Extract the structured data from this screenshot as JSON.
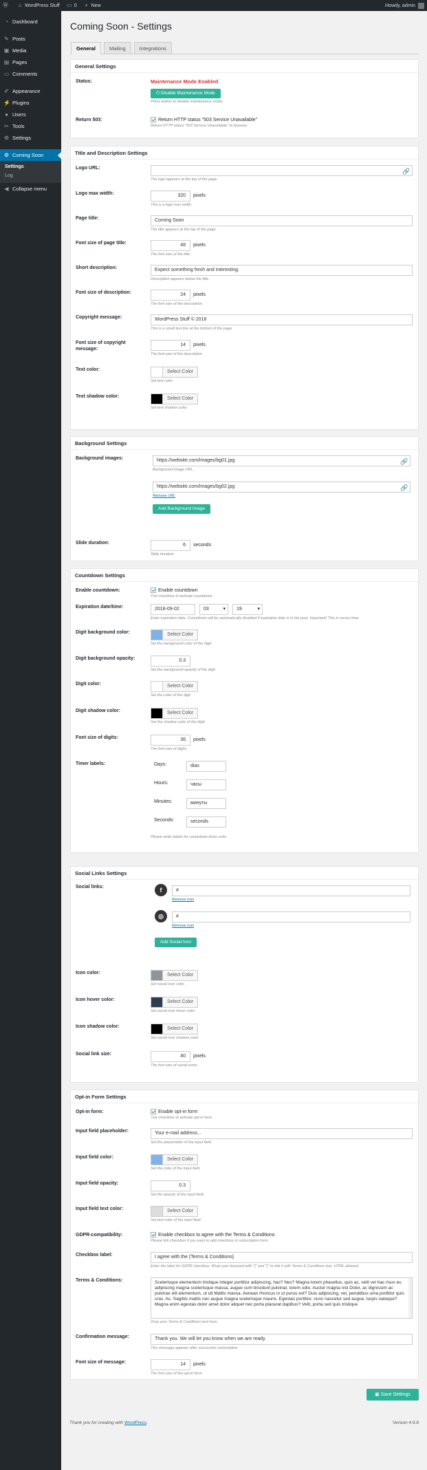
{
  "adminbar": {
    "wp_logo": "wordpress-icon",
    "site_name": "WordPress Stuff",
    "comments_count": "0",
    "new_label": "New",
    "howdy": "Howdy, admin"
  },
  "sidebar": {
    "items": [
      {
        "label": "Dashboard",
        "icon": "dashboard-icon"
      },
      {
        "label": "Posts",
        "icon": "pin-icon"
      },
      {
        "label": "Media",
        "icon": "media-icon"
      },
      {
        "label": "Pages",
        "icon": "page-icon"
      },
      {
        "label": "Comments",
        "icon": "comment-icon"
      },
      {
        "label": "Appearance",
        "icon": "brush-icon"
      },
      {
        "label": "Plugins",
        "icon": "plug-icon"
      },
      {
        "label": "Users",
        "icon": "user-icon"
      },
      {
        "label": "Tools",
        "icon": "wrench-icon"
      },
      {
        "label": "Settings",
        "icon": "settings-icon"
      },
      {
        "label": "Coming Soon",
        "icon": "gear-icon"
      }
    ],
    "sub": [
      "Settings",
      "Log"
    ],
    "collapse": "Collapse menu"
  },
  "page": {
    "title": "Coming Soon - Settings",
    "tabs": [
      "General",
      "Mailing",
      "Integrations"
    ]
  },
  "general": {
    "heading": "General Settings",
    "status_label": "Status:",
    "status_value": "Maintenance Mode Enabled",
    "disable_btn": "Disable Maintenance Mode",
    "disable_desc": "Press button to disable maintenance mode.",
    "r503_label": "Return 503:",
    "r503_check": "Return HTTP status \"503 Service Unavailable\"",
    "r503_desc": "Return HTTP status \"503 Service Unavailable\" to browser."
  },
  "title_desc": {
    "heading": "Title and Description Settings",
    "logo_url_label": "Logo URL:",
    "logo_url_value": "",
    "logo_url_desc": "The logo appears at the top of the page.",
    "logo_max_label": "Logo max width:",
    "logo_max_value": "320",
    "logo_max_unit": "pixels",
    "logo_max_desc": "This is a logo max width.",
    "page_title_label": "Page title:",
    "page_title_value": "Coming Soon",
    "page_title_desc": "The title appears at the top of the page.",
    "font_title_label": "Font size of page title:",
    "font_title_value": "48",
    "font_title_unit": "pixels",
    "font_title_desc": "The font size of the title.",
    "short_desc_label": "Short description:",
    "short_desc_value": "Expect something fresh and interesting.",
    "short_desc_desc": "Description appears below the title.",
    "font_desc_label": "Font size of description:",
    "font_desc_value": "24",
    "font_desc_unit": "pixels",
    "font_desc_desc": "The font size of the description.",
    "copyright_label": "Copyright message:",
    "copyright_value": "WordPress Stuff © 2018",
    "copyright_desc": "This is a small text line at the bottom of the page.",
    "font_copy_label": "Font size of copyright message:",
    "font_copy_value": "14",
    "font_copy_unit": "pixels",
    "font_copy_desc": "The font size of the description.",
    "text_color_label": "Text color:",
    "text_color_btn": "Select Color",
    "text_color_desc": "Set text color.",
    "text_color_value": "#ffffff",
    "shadow_color_label": "Text shadow color:",
    "shadow_color_btn": "Select Color",
    "shadow_color_desc": "Set text shadow color.",
    "shadow_color_value": "#000000"
  },
  "background": {
    "heading": "Background Settings",
    "images_label": "Background images:",
    "image1": "https://website.com/images/bg01.jpg",
    "image1_desc": "Background image URL.",
    "image2": "https://website.com/images/bg02.jpg",
    "remove_url": "Remove URL",
    "add_btn": "Add Background Image",
    "slide_label": "Slide duration:",
    "slide_value": "6",
    "slide_unit": "seconds",
    "slide_desc": "Slide duration."
  },
  "countdown": {
    "heading": "Countdown Settings",
    "enable_label": "Enable countdown:",
    "enable_check": "Enable countdown",
    "enable_desc": "Tick checkbox to activate countdown.",
    "exp_label": "Expiration date/time:",
    "exp_date": "2018-09-02",
    "exp_hour": "03",
    "exp_min": "19",
    "exp_desc": "Enter expiration date. Countdown will be automatically disabled if expiration date is in the past. Important! This is server time.",
    "digit_bg_label": "Digit background color:",
    "digit_bg_btn": "Select Color",
    "digit_bg_desc": "Set the background color of the digit.",
    "digit_bg_value": "#7fb3e6",
    "digit_op_label": "Digit background opacity:",
    "digit_op_value": "0.3",
    "digit_op_desc": "Set the background opacity of the digit.",
    "digit_color_label": "Digit color:",
    "digit_color_btn": "Select Color",
    "digit_color_desc": "Set the color of the digit.",
    "digit_color_value": "#ffffff",
    "digit_shadow_label": "Digit shadow color:",
    "digit_shadow_btn": "Select Color",
    "digit_shadow_desc": "Set the shadow color of the digit.",
    "digit_shadow_value": "#000000",
    "font_digits_label": "Font size of digits:",
    "font_digits_value": "36",
    "font_digits_unit": "pixels",
    "font_digits_desc": "The font size of digits.",
    "timer_label": "Timer labels:",
    "days_l": "Days:",
    "days_v": "dias",
    "hours_l": "Hours:",
    "hours_v": "часы",
    "minutes_l": "Minutes:",
    "minutes_v": "минуты",
    "seconds_l": "Seconds:",
    "seconds_v": "seconds",
    "timer_desc": "Please enter labels for countdown timer units."
  },
  "social": {
    "heading": "Social Links Settings",
    "links_label": "Social links:",
    "link1": "#",
    "link1_icon": "facebook-icon",
    "remove1": "Remove icon",
    "link2": "#",
    "link2_icon": "instagram-icon",
    "remove2": "Remove icon",
    "add_btn": "Add Social Icon",
    "icon_color_label": "Icon color:",
    "icon_color_btn": "Select Color",
    "icon_color_desc": "Set social icon color.",
    "icon_color_value": "#8f959c",
    "icon_hover_label": "Icon hover color:",
    "icon_hover_btn": "Select Color",
    "icon_hover_desc": "Set social icon hover color.",
    "icon_hover_value": "#2c3e50",
    "icon_shadow_label": "Icon shadow color:",
    "icon_shadow_btn": "Select Color",
    "icon_shadow_desc": "Set social icon shadow color.",
    "icon_shadow_value": "#000000",
    "size_label": "Social link size:",
    "size_value": "40",
    "size_unit": "pixels",
    "size_desc": "The font size of social icons."
  },
  "optin": {
    "heading": "Opt-in Form Settings",
    "form_label": "Opt-in form:",
    "form_check": "Enable opt-in form",
    "form_desc": "Tick checkbox to activate opt-in form.",
    "placeholder_label": "Input field placeholder:",
    "placeholder_value": "Your e-mail address...",
    "placeholder_desc": "Set the placeholder of the input field.",
    "field_color_label": "Input field color:",
    "field_color_btn": "Select Color",
    "field_color_desc": "Set the color of the input field.",
    "field_color_value": "#7fb3e6",
    "field_op_label": "Input field opacity:",
    "field_op_value": "0.3",
    "field_op_desc": "Set the opacity of the input field.",
    "text_color_label": "Input field text color:",
    "text_color_btn": "Select Color",
    "text_color_desc": "Set text color of the input field.",
    "text_color_value": "#dddddd",
    "gdpr_label": "GDPR-compatibility:",
    "gdpr_check": "Enable checkbox to agree with the Terms & Conditions",
    "gdpr_desc": "Please tick checkbox if you want to add checkbox to subscription form.",
    "cb_label": "Checkbox label:",
    "cb_value": "I agree with the {Terms & Conditions}",
    "cb_desc": "Enter the label for GDPR checkbox. Wrap your keyword with \"{\" and \"}\" to link it with Terms & Conditions box. HTML allowed.",
    "terms_label": "Terms & Conditions:",
    "terms_value": "Scelerisque elementum tristique integer porttitor adipiscing, hac? Nec? Magna lorem phasellus, quis ac, velit vel hac risus eu adipiscing magna scelerisque massa, augue cum tincidunt pulvinar, lorem odio. Auctor magna nisl Dolor, ac dignissim ac pulvinar elit elementum, ut ult Mattis massa. Aenean rhoncus in ut purus est? Duis adipiscing, vel, penatibus uma porttitor quis cras. Ac. Sagittis mattis nec augue magna scelerisque mauris. Egestas porttitor, nunc nascetur sed augue, turpis natoque? Magna enim egestas dolor amet dolor aliquet nec porta placerat dapibus? Velit, porta sed quis tristique",
    "terms_desc": "Drop your Terms & Conditions text here.",
    "confirm_label": "Confirmation message:",
    "confirm_value": "Thank you. We will let you know when we are ready.",
    "confirm_desc": "This message appears after successful subscription.",
    "font_label": "Font size of message:",
    "font_value": "14",
    "font_unit": "pixels",
    "font_desc": "The font size of the opt-in form."
  },
  "footer": {
    "save_btn": "Save Settings",
    "thanks": "Thank you for creating with ",
    "wp_link": "WordPress",
    "version": "Version 4.9.8"
  }
}
